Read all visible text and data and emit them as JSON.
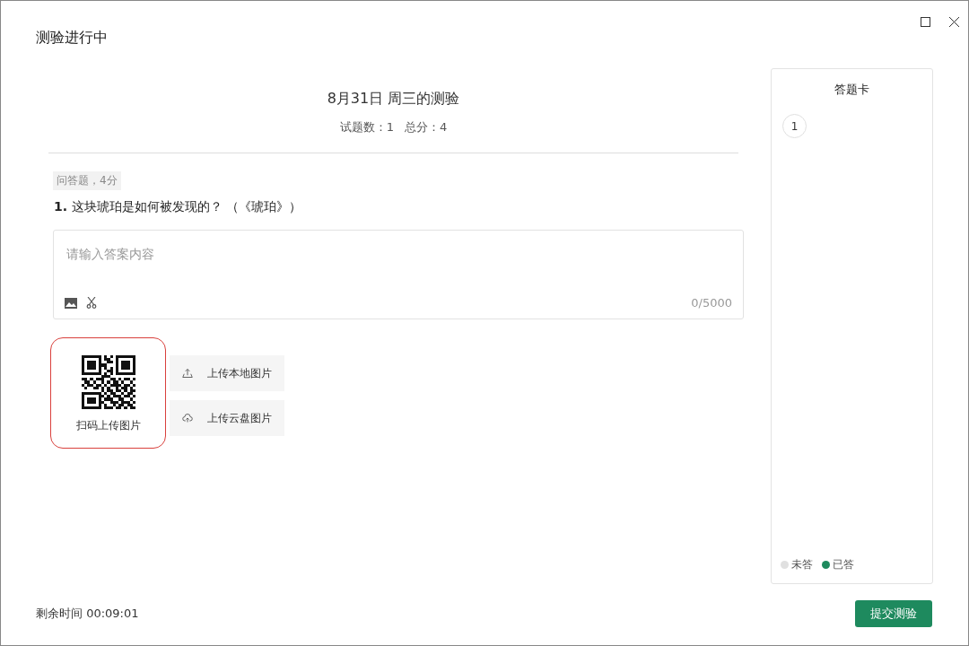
{
  "window": {
    "title": "测验进行中"
  },
  "quiz": {
    "title": "8月31日 周三的测验",
    "question_count_label": "试题数：",
    "question_count": "1",
    "total_label": "总分：",
    "total": "4"
  },
  "question": {
    "tag": "问答题，4分",
    "number": "1.",
    "text": "这块琥珀是如何被发现的？ （《琥珀》）",
    "answer": {
      "placeholder": "请输入答案内容",
      "counter": "0/5000"
    }
  },
  "upload": {
    "qr_label": "扫码上传图片",
    "buttons": [
      {
        "kind": "local",
        "label": "上传本地图片"
      },
      {
        "kind": "cloud",
        "label": "上传云盘图片"
      }
    ]
  },
  "answer_card": {
    "title": "答题卡",
    "items": [
      {
        "label": "1",
        "answered": false
      }
    ],
    "legend": [
      {
        "label": "未答",
        "color": "#e0e0e0"
      },
      {
        "label": "已答",
        "color": "#1e8a5e"
      }
    ]
  },
  "footer": {
    "time_label": "剩余时间",
    "time": "00:09:01",
    "submit": "提交测验"
  }
}
